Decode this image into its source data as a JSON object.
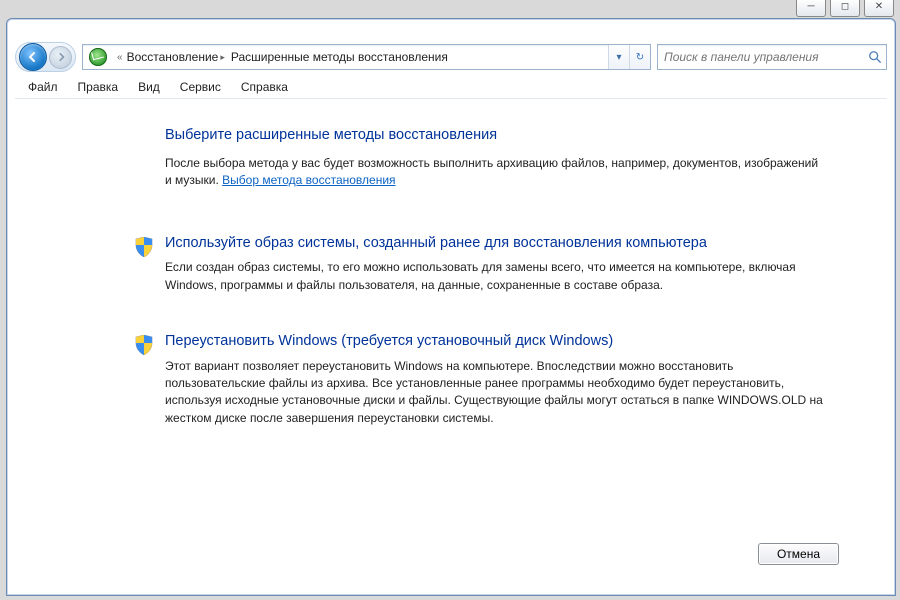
{
  "titlebar": {
    "minimize_glyph": "─",
    "maximize_glyph": "◻",
    "close_glyph": "✕"
  },
  "breadcrumb": {
    "sep_glyph": "«",
    "chev_glyph": "▸",
    "part1": "Восстановление",
    "part2": "Расширенные методы восстановления",
    "dropdown_glyph": "▾",
    "refresh_glyph": "↻"
  },
  "search": {
    "placeholder": "Поиск в панели управления"
  },
  "menu": {
    "file": "Файл",
    "edit": "Правка",
    "view": "Вид",
    "tools": "Сервис",
    "help": "Справка"
  },
  "page": {
    "title": "Выберите расширенные методы восстановления",
    "intro_before": "После выбора метода у вас будет возможность выполнить архивацию файлов, например, документов, изображений и музыки. ",
    "intro_link": "Выбор метода восстановления"
  },
  "option1": {
    "title": "Используйте образ системы, созданный ранее для восстановления компьютера",
    "body": "Если создан образ системы, то его можно использовать для замены всего, что имеется на компьютере, включая Windows, программы и файлы пользователя, на данные, сохраненные в составе образа."
  },
  "option2": {
    "title": "Переустановить Windows (требуется установочный диск Windows)",
    "body": "Этот вариант позволяет переустановить Windows на компьютере. Впоследствии можно восстановить пользовательские файлы из архива. Все установленные ранее программы необходимо будет переустановить, используя исходные установочные диски и файлы. Существующие файлы могут остаться в папке WINDOWS.OLD на жестком диске после завершения переустановки системы."
  },
  "buttons": {
    "cancel": "Отмена"
  }
}
